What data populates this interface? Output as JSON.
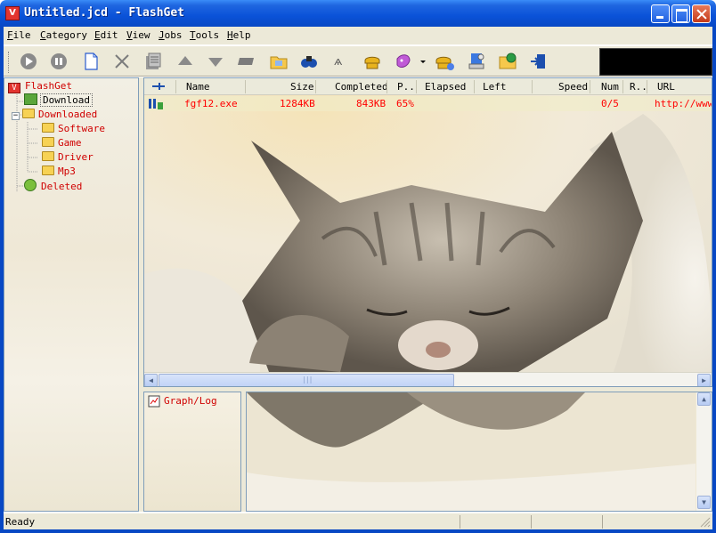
{
  "window": {
    "title": "Untitled.jcd - FlashGet"
  },
  "menu": [
    {
      "label": "File",
      "key": "F",
      "rest": "ile"
    },
    {
      "label": "Category",
      "key": "C",
      "rest": "ategory"
    },
    {
      "label": "Edit",
      "key": "E",
      "rest": "dit"
    },
    {
      "label": "View",
      "key": "V",
      "rest": "iew"
    },
    {
      "label": "Jobs",
      "key": "J",
      "rest": "obs"
    },
    {
      "label": "Tools",
      "key": "T",
      "rest": "ools"
    },
    {
      "label": "Help",
      "key": "H",
      "rest": "elp"
    }
  ],
  "toolbar": {
    "buttons": [
      "start-icon",
      "pause-icon",
      "new-job-icon",
      "delete-icon",
      "properties-icon",
      "move-up-icon",
      "move-down-icon",
      "dropzone-icon",
      "folder-open-icon",
      "find-icon",
      "find-next-icon",
      "dial-icon",
      "color-icon",
      "dropdown-arrow-icon",
      "hangup-icon",
      "options-icon",
      "site-explorer-icon",
      "exit-icon"
    ]
  },
  "tree": {
    "root": "FlashGet",
    "download": "Download",
    "downloaded": "Downloaded",
    "children": [
      "Software",
      "Game",
      "Driver",
      "Mp3"
    ],
    "deleted": "Deleted"
  },
  "list": {
    "columns": [
      "Name",
      "Size",
      "Completed",
      "P..",
      "Elapsed",
      "Left",
      "Speed",
      "Num",
      "R..",
      "URL"
    ],
    "rows": [
      {
        "name": "fgf12.exe",
        "size": "1284KB",
        "completed": "843KB",
        "percent": "65%",
        "elapsed": "",
        "left": "",
        "speed": "",
        "num": "0/5",
        "r": "",
        "url": "http://www."
      }
    ]
  },
  "graph": {
    "title": "Graph/Log"
  },
  "status": {
    "text": "Ready"
  }
}
